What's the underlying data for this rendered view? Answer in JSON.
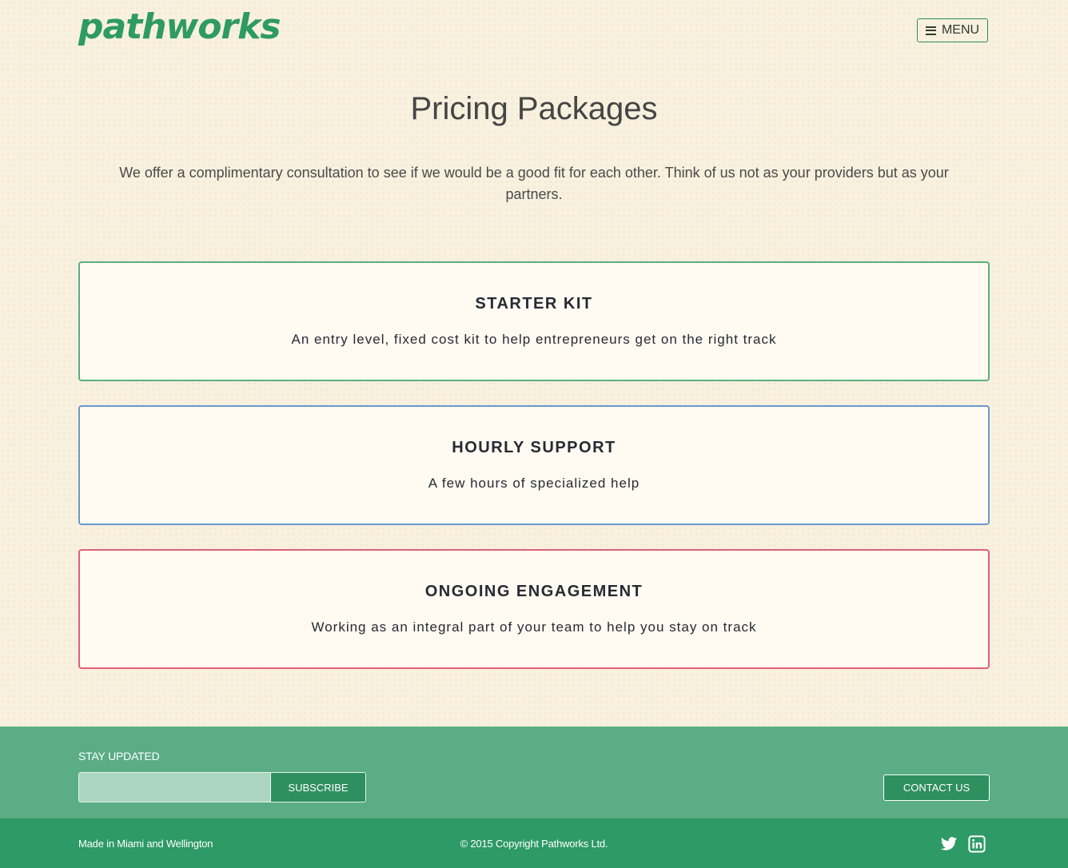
{
  "header": {
    "logo_text": "pathworks",
    "menu_label": "MENU"
  },
  "main": {
    "title": "Pricing Packages",
    "intro": "We offer a complimentary consultation to see if we would be a good fit for each other. Think of us not as your providers but as your partners.",
    "packages": [
      {
        "title": "STARTER KIT",
        "description": "An entry level, fixed cost kit to help entrepreneurs get on the right track",
        "border_color": "#5aae80"
      },
      {
        "title": "HOURLY SUPPORT",
        "description": "A few hours of specialized help",
        "border_color": "#6a98cc"
      },
      {
        "title": "ONGOING ENGAGEMENT",
        "description": "Working as an integral part of your team to help you stay on track",
        "border_color": "#e0607a"
      }
    ]
  },
  "footer": {
    "stay_updated_label": "STAY UPDATED",
    "email_value": "",
    "subscribe_label": "SUBSCRIBE",
    "contact_label": "CONTACT US",
    "made_in": "Made in Miami and Wellington",
    "copyright": "© 2015 Copyright Pathworks Ltd.",
    "social_icons": [
      "twitter-icon",
      "linkedin-icon"
    ]
  },
  "colors": {
    "brand_green": "#2e9a66",
    "footer_top": "#5aad84",
    "background": "#f9f1df"
  }
}
